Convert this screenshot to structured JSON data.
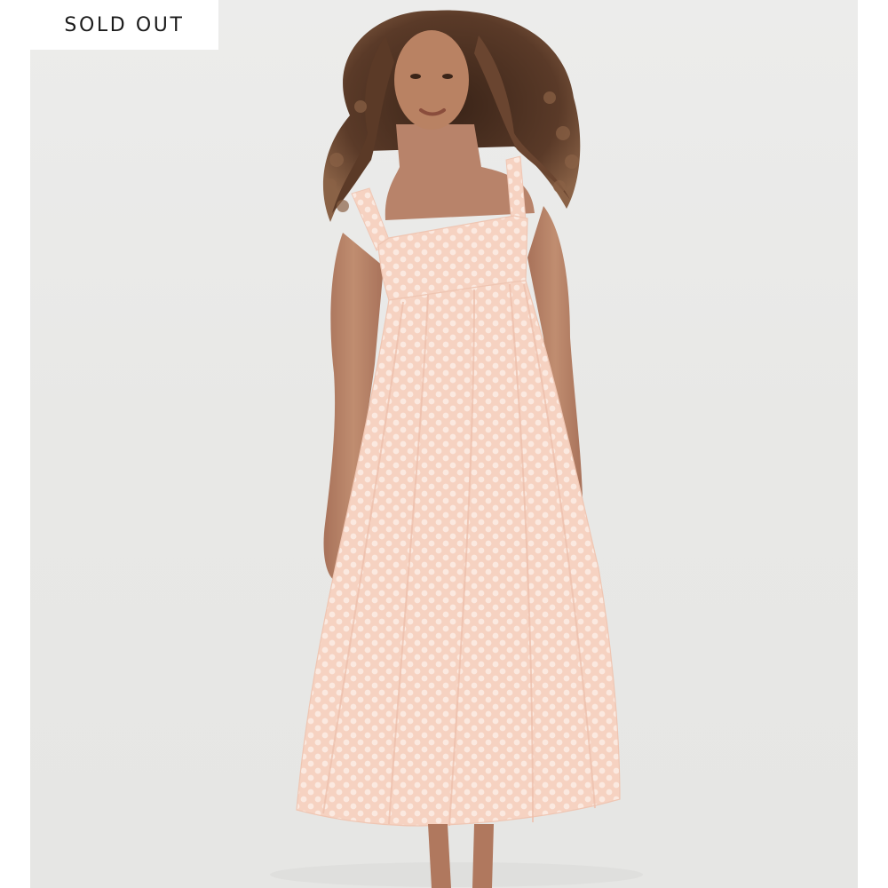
{
  "product": {
    "badge_label": "SOLD OUT",
    "image_subject_icon": "model-in-dress-illustration",
    "colors": {
      "background": "#e9e9e7",
      "dress": "#f6d3c2",
      "dress_pattern": "#fbe8df",
      "skin": "#b98567",
      "hair": "#4a2f22",
      "badge_bg": "#ffffff",
      "badge_text": "#1b1b1b"
    }
  }
}
